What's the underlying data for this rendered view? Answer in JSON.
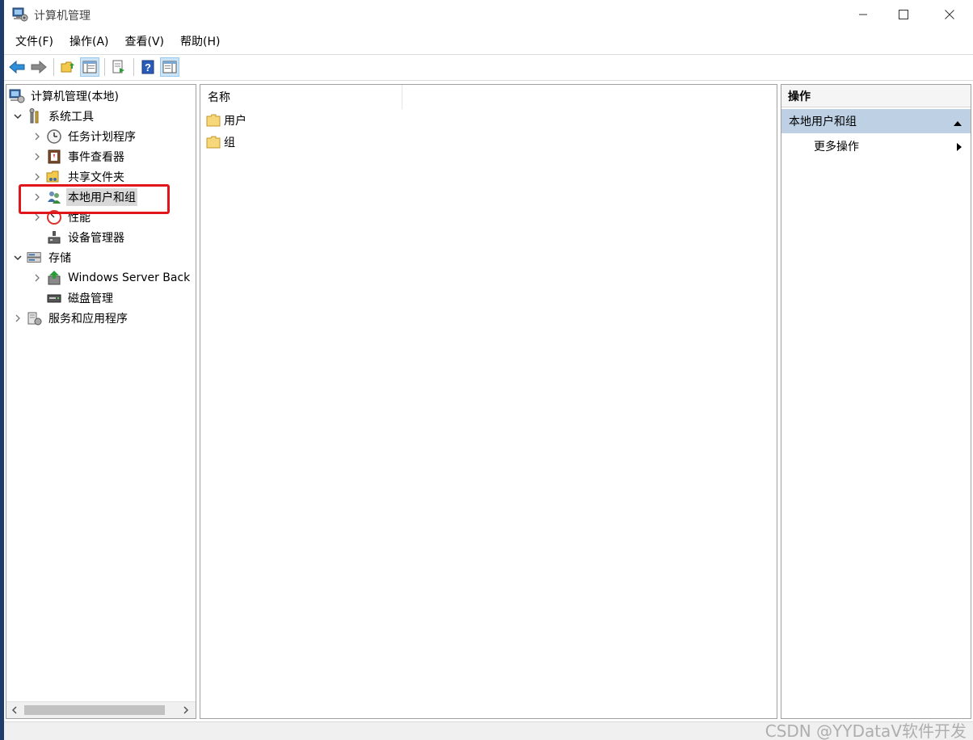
{
  "window": {
    "title": "计算机管理",
    "controls": [
      "minimize",
      "maximize",
      "close"
    ]
  },
  "menu": [
    "文件(F)",
    "操作(A)",
    "查看(V)",
    "帮助(H)"
  ],
  "toolbar": {
    "buttons": [
      "back-icon",
      "forward-icon",
      "up-folder-icon",
      "show-hide-tree-icon",
      "export-list-icon",
      "help-icon",
      "show-hide-action-pane-icon"
    ]
  },
  "tree": {
    "root": "计算机管理(本地)",
    "system_tools": "系统工具",
    "task_scheduler": "任务计划程序",
    "event_viewer": "事件查看器",
    "shared_folders": "共享文件夹",
    "local_users_groups": "本地用户和组",
    "performance": "性能",
    "device_manager": "设备管理器",
    "storage": "存储",
    "windows_server_backup": "Windows Server Back",
    "disk_management": "磁盘管理",
    "services_apps": "服务和应用程序"
  },
  "center": {
    "column_name": "名称",
    "items": [
      "用户",
      "组"
    ]
  },
  "actions": {
    "title": "操作",
    "group": "本地用户和组",
    "more": "更多操作"
  },
  "watermark": "CSDN @YYDataV软件开发",
  "colors": {
    "highlight_border": "#e0161b",
    "action_group_bg": "#bdd0e4",
    "selected_bg": "#d9d9d9"
  }
}
